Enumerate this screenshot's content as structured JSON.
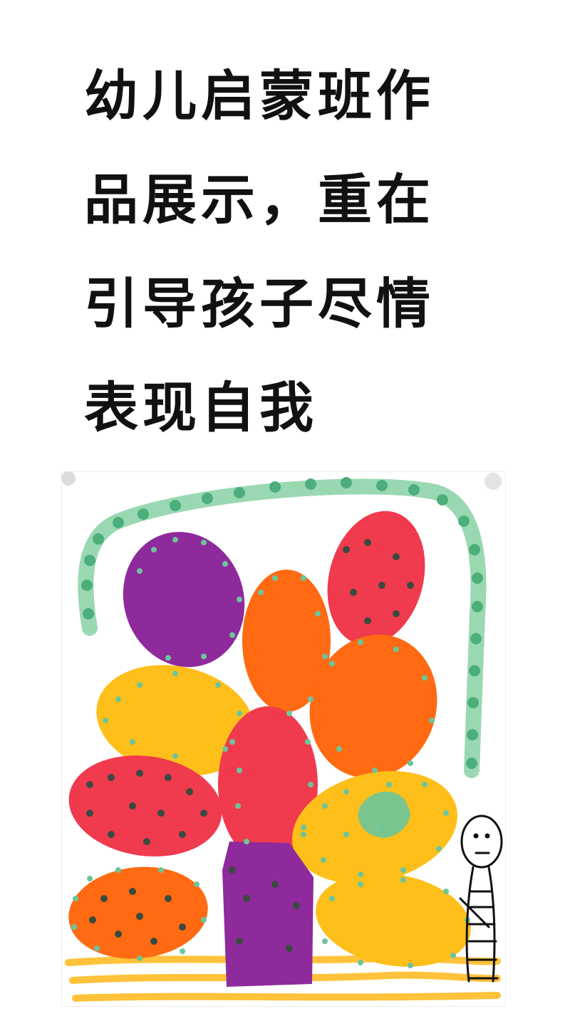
{
  "caption": {
    "lines": [
      "幼儿启蒙班作",
      "品展示，重在",
      "引导孩子尽情",
      "表现自我"
    ]
  },
  "artwork": {
    "colors": {
      "paper": "#ffffff",
      "purple": "#8e2a9c",
      "orange": "#ff6a12",
      "red": "#f03a4e",
      "yellow": "#ffbf1a",
      "green": "#6cc59a",
      "dark_dot": "#3b4a40",
      "arch_green": "#7fcf9e",
      "ground": "#ffc23a"
    }
  }
}
